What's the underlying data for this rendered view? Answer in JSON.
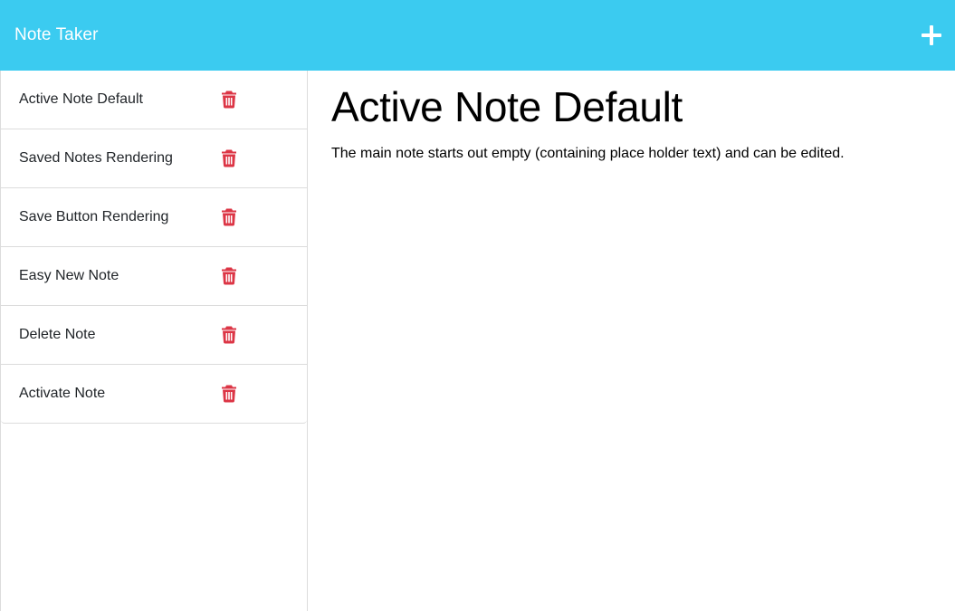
{
  "navbar": {
    "brand": "Note Taker",
    "new_note_icon": "plus-icon"
  },
  "sidebar": {
    "notes": [
      {
        "title": "Active Note Default",
        "delete_icon": "trash-icon"
      },
      {
        "title": "Saved Notes Rendering",
        "delete_icon": "trash-icon"
      },
      {
        "title": "Save Button Rendering",
        "delete_icon": "trash-icon"
      },
      {
        "title": "Easy New Note",
        "delete_icon": "trash-icon"
      },
      {
        "title": "Delete Note",
        "delete_icon": "trash-icon"
      },
      {
        "title": "Activate Note",
        "delete_icon": "trash-icon"
      }
    ]
  },
  "main": {
    "note_title": "Active Note Default",
    "note_text": "The main note starts out empty (containing place holder text) and can be edited."
  },
  "colors": {
    "navbar_bg": "#3bcbf0",
    "trash_icon": "#dc3545"
  }
}
